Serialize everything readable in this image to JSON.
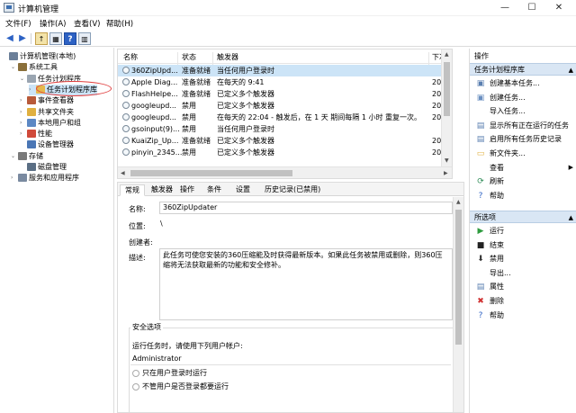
{
  "window": {
    "title": "计算机管理",
    "controls": [
      "—",
      "☐",
      "✕"
    ]
  },
  "menu": [
    "文件(F)",
    "操作(A)",
    "查看(V)",
    "帮助(H)"
  ],
  "toolbar": {
    "icons": [
      "back-icon",
      "forward-icon",
      "up-folder-icon",
      "show-hide-tree-icon",
      "help-icon",
      "console-icon"
    ]
  },
  "tree": [
    {
      "label": "计算机管理(本地)",
      "level": 0,
      "exp": "",
      "icon": "computer-icon",
      "color": "#6b7f99"
    },
    {
      "label": "系统工具",
      "level": 1,
      "exp": "⌄",
      "icon": "tools-icon",
      "color": "#8a6f3a"
    },
    {
      "label": "任务计划程序",
      "level": 2,
      "exp": "⌄",
      "icon": "clock-icon",
      "color": "#9aa5b1"
    },
    {
      "label": "任务计划程序库",
      "level": 3,
      "exp": "›",
      "icon": "folder-icon",
      "color": "#e6b84c",
      "selected": true
    },
    {
      "label": "事件查看器",
      "level": 2,
      "exp": "›",
      "icon": "event-viewer-icon",
      "color": "#b85a3a"
    },
    {
      "label": "共享文件夹",
      "level": 2,
      "exp": "›",
      "icon": "shared-folder-icon",
      "color": "#e0b040"
    },
    {
      "label": "本地用户和组",
      "level": 2,
      "exp": "›",
      "icon": "users-icon",
      "color": "#5c88c4"
    },
    {
      "label": "性能",
      "level": 2,
      "exp": "›",
      "icon": "performance-icon",
      "color": "#d04a3a"
    },
    {
      "label": "设备管理器",
      "level": 2,
      "exp": "",
      "icon": "device-manager-icon",
      "color": "#4a76b5"
    },
    {
      "label": "存储",
      "level": 1,
      "exp": "⌄",
      "icon": "storage-icon",
      "color": "#7a7a7a"
    },
    {
      "label": "磁盘管理",
      "level": 2,
      "exp": "",
      "icon": "disk-icon",
      "color": "#5a6e84"
    },
    {
      "label": "服务和应用程序",
      "level": 1,
      "exp": "›",
      "icon": "services-icon",
      "color": "#7a8aa0"
    }
  ],
  "task_list": {
    "headers": [
      "名称",
      "状态",
      "触发器",
      "下次运"
    ],
    "rows": [
      [
        "360ZipUpd...",
        "准备就绪",
        "当任何用户登录时",
        ""
      ],
      [
        "Apple Diag...",
        "准备就绪",
        "在每天的 9:41",
        "2020/1"
      ],
      [
        "FlashHelpe...",
        "准备就绪",
        "已定义多个触发器",
        "2020/1"
      ],
      [
        "googleupd...",
        "禁用",
        "已定义多个触发器",
        "2020/1"
      ],
      [
        "googleupd...",
        "禁用",
        "在每天的 22:04 - 触发后，在 1 天 期间每隔 1 小时 重复一次。",
        "2020/1"
      ],
      [
        "gsoinput(9)...",
        "禁用",
        "当任何用户登录时",
        ""
      ],
      [
        "KuaiZip_Up...",
        "准备就绪",
        "已定义多个触发器",
        "2020/1"
      ],
      [
        "pinyin_2345...",
        "禁用",
        "已定义多个触发器",
        "2020/1"
      ]
    ]
  },
  "details": {
    "tabs": [
      "常规",
      "触发器",
      "操作",
      "条件",
      "设置",
      "历史记录(已禁用)"
    ],
    "name_label": "名称:",
    "name_value": "360ZipUpdater",
    "location_label": "位置:",
    "location_value": "\\",
    "author_label": "创建者:",
    "author_value": "",
    "desc_label": "描述:",
    "desc_value": "此任务可使您安装的360压缩能及时获得最新版本。如果此任务被禁用或删除，则360压缩将无法获取最新的功能和安全修补。",
    "security_title": "安全选项",
    "run_as_label": "运行任务时，请使用下列用户帐户:",
    "run_as_user": "Administrator",
    "option1": "只在用户登录时运行",
    "option2": "不管用户是否登录都要运行"
  },
  "actions": {
    "title": "操作",
    "section1": "任务计划程序库",
    "items1": [
      {
        "label": "创建基本任务...",
        "icon": "create-basic-task-icon",
        "glyph": "▣",
        "color": "#5a7fb0"
      },
      {
        "label": "创建任务...",
        "icon": "create-task-icon",
        "glyph": "▣",
        "color": "#6a8fc0"
      },
      {
        "label": "导入任务...",
        "icon": "import-task-icon",
        "glyph": "",
        "color": "#000"
      },
      {
        "label": "显示所有正在运行的任务",
        "icon": "running-tasks-icon",
        "glyph": "▤",
        "color": "#5a7fb0"
      },
      {
        "label": "启用所有任务历史记录",
        "icon": "enable-history-icon",
        "glyph": "▤",
        "color": "#5a7fb0"
      },
      {
        "label": "新文件夹...",
        "icon": "new-folder-icon",
        "glyph": "▭",
        "color": "#e0b040"
      },
      {
        "label": "查看",
        "icon": "view-icon",
        "glyph": "",
        "color": "#000",
        "submenu": true
      },
      {
        "label": "刷新",
        "icon": "refresh-icon",
        "glyph": "⟳",
        "color": "#2e8b57"
      },
      {
        "label": "帮助",
        "icon": "help-icon",
        "glyph": "?",
        "color": "#2d62c4"
      }
    ],
    "section2": "所选项",
    "items2": [
      {
        "label": "运行",
        "icon": "run-icon",
        "glyph": "▶",
        "color": "#2e9b3e"
      },
      {
        "label": "结束",
        "icon": "end-icon",
        "glyph": "■",
        "color": "#222"
      },
      {
        "label": "禁用",
        "icon": "disable-icon",
        "glyph": "⬇",
        "color": "#333"
      },
      {
        "label": "导出...",
        "icon": "export-icon",
        "glyph": "",
        "color": "#000"
      },
      {
        "label": "属性",
        "icon": "properties-icon",
        "glyph": "▤",
        "color": "#5a7fb0"
      },
      {
        "label": "删除",
        "icon": "delete-icon",
        "glyph": "✖",
        "color": "#d03030"
      },
      {
        "label": "帮助",
        "icon": "help-icon",
        "glyph": "?",
        "color": "#2d62c4"
      }
    ]
  }
}
